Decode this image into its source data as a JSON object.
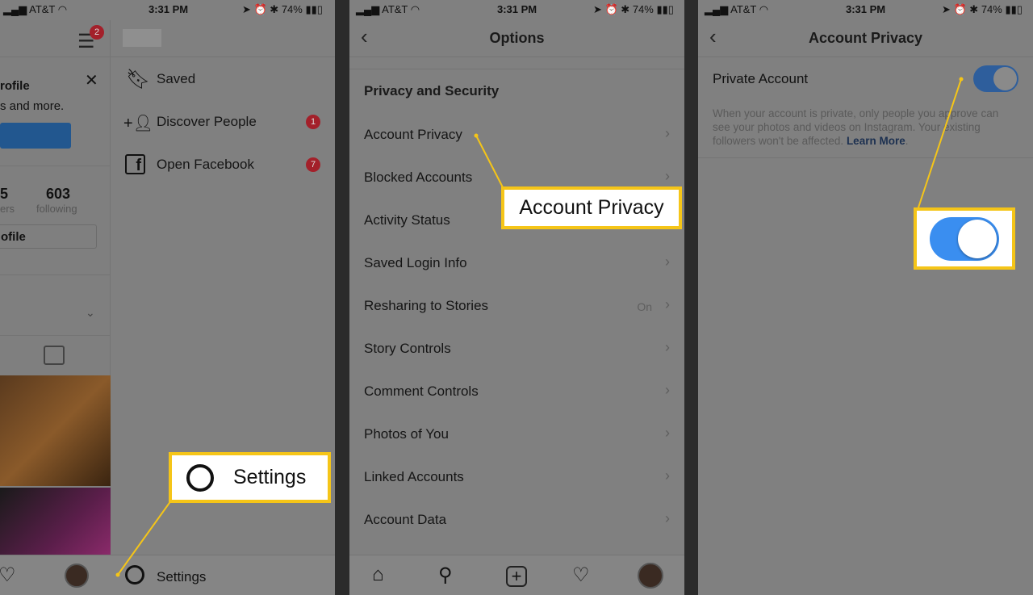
{
  "status_bar": {
    "carrier": "AT&T",
    "time": "3:31 PM",
    "battery": "74%"
  },
  "panel1": {
    "profile": {
      "banner_title": "rofile",
      "banner_text": "s and more.",
      "followers_partial": "5",
      "followers_label_partial": "ers",
      "following_count": "603",
      "following_label": "following",
      "edit_profile_partial": "ofile",
      "menu_badge": "2"
    },
    "menu": {
      "items": [
        {
          "label": "Saved",
          "icon": "bookmark-icon"
        },
        {
          "label": "Discover People",
          "icon": "add-person-icon",
          "badge": "1"
        },
        {
          "label": "Open Facebook",
          "icon": "facebook-icon",
          "badge": "7"
        }
      ],
      "settings_label": "Settings"
    },
    "callout_label": "Settings"
  },
  "panel2": {
    "title": "Options",
    "section": "Privacy and Security",
    "items": [
      {
        "label": "Account Privacy"
      },
      {
        "label": "Blocked Accounts"
      },
      {
        "label": "Activity Status"
      },
      {
        "label": "Saved Login Info"
      },
      {
        "label": "Resharing to Stories",
        "value": "On"
      },
      {
        "label": "Story Controls"
      },
      {
        "label": "Comment Controls"
      },
      {
        "label": "Photos of You"
      },
      {
        "label": "Linked Accounts"
      },
      {
        "label": "Account Data"
      }
    ],
    "callout_label": "Account Privacy"
  },
  "panel3": {
    "title": "Account Privacy",
    "private_label": "Private Account",
    "private_on": true,
    "description": "When your account is private, only people you approve can see your photos and videos on Instagram. Your existing followers won't be affected.",
    "learn_more": "Learn More"
  },
  "colors": {
    "highlight": "#f5c518",
    "toggle": "#2e6ab0",
    "badge": "#a3202a"
  }
}
